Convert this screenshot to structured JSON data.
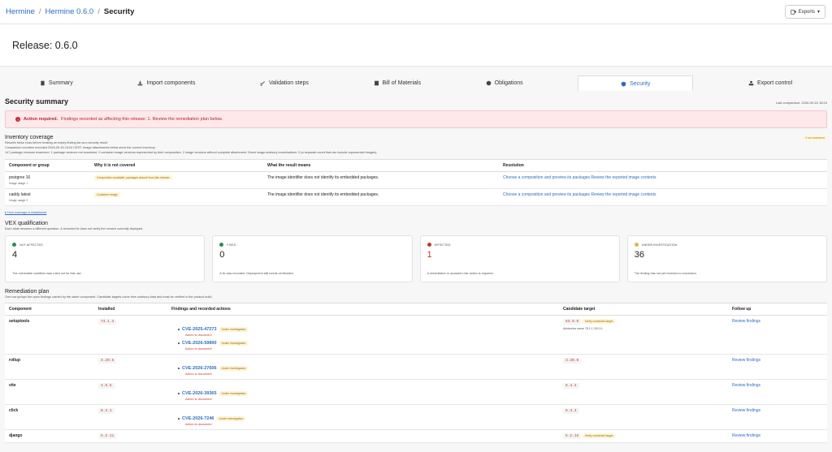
{
  "breadcrumb": {
    "root": "Hermine",
    "release": "Hermine 0.6.0",
    "current": "Security"
  },
  "header": {
    "exports_label": "Exports",
    "release_title": "Release: 0.6.0"
  },
  "tabs": [
    {
      "label": "Summary",
      "icon": "document-icon"
    },
    {
      "label": "Import components",
      "icon": "import-icon"
    },
    {
      "label": "Validation steps",
      "icon": "checks-icon"
    },
    {
      "label": "Bill of Materials",
      "icon": "book-icon"
    },
    {
      "label": "Obligations",
      "icon": "circle-icon"
    },
    {
      "label": "Security",
      "icon": "shield-icon",
      "active": true
    },
    {
      "label": "Export control",
      "icon": "export-icon"
    }
  ],
  "security": {
    "title": "Security summary",
    "last_comparison": "Last comparison: 2026-09-16 18:24",
    "alert_strong": "Action required.",
    "alert_text": "Findings recorded as affecting this release: 1. Review the remediation plan below."
  },
  "inventory": {
    "title": "Inventory coverage",
    "badge": "3 not examined",
    "line1": "Resolve these rows before treating an empty finding list as a security result.",
    "line2": "Comparison counters recorded 2026-09-16 18:24 CEST. Image attachments below show the current inventory.",
    "line3": "147 package versions examined. 1 package versions not examined. 0 container image versions represented by their composition. 2 image versions without complete attachment. Direct image advisory examinations: 0 (a separate count that can include represented images).",
    "columns": [
      "Component or group",
      "Why it is not covered",
      "What the result means",
      "Resolution"
    ],
    "rows": [
      {
        "name": "postgres 16",
        "sub": "Image usage 1",
        "why": "Composition available; packages absent from this release",
        "meaning": "The image identifier does not identify its embedded packages.",
        "resolution": "Choose a composition and preview its packages Review the reported image contents"
      },
      {
        "name": "caddy latest",
        "sub": "Image usage 2",
        "why": "Container image",
        "meaning": "The image identifier does not identify its embedded packages.",
        "resolution": "Choose a composition and preview its packages Review the reported image contents"
      }
    ],
    "how_link": "▸ How coverage is established"
  },
  "vex": {
    "title": "VEX qualification",
    "subtitle": "Each state answers a different question. A recorded fix does not verify the version currently deployed.",
    "cards": [
      {
        "label": "NOT AFFECTED",
        "value": "4",
        "desc": "The vulnerable condition was ruled out for this use.",
        "color": "#2e8b57"
      },
      {
        "label": "FIXED",
        "value": "0",
        "desc": "A fix was recorded. Deployment still needs verification.",
        "color": "#2e8b57"
      },
      {
        "label": "AFFECTED",
        "value": "1",
        "desc": "A remediation or accepted risk action is required.",
        "color": "#c0392b"
      },
      {
        "label": "UNDER INVESTIGATION",
        "value": "36",
        "desc": "The finding has not yet received a conclusion.",
        "color": "#e0b84a"
      }
    ]
  },
  "remediation": {
    "title": "Remediation plan",
    "subtitle": "One row groups the open findings carried by the same component. Candidate targets come from advisory data and must be verified in the product build.",
    "columns": [
      "Component",
      "Installed",
      "Findings and recorded actions",
      "Candidate target",
      "Follow up"
    ],
    "rows": [
      {
        "component": "setuptools",
        "installed": "74.1.3",
        "findings": [
          {
            "cve": "CVE-2025-47273",
            "status": "Under investigation",
            "action": "Action to document"
          },
          {
            "cve": "CVE-2026-59890",
            "status": "Under investigation",
            "action": "Action to document"
          }
        ],
        "target": "83.0.0",
        "target_badge": "Verify combined target",
        "target_note": "Advisories name 78.1.1, 83.0.0.",
        "follow": "Review findings"
      },
      {
        "component": "rollup",
        "installed": "3.29.5",
        "findings": [
          {
            "cve": "CVE-2026-27606",
            "status": "Under investigation",
            "action": "Action to document"
          }
        ],
        "target": "3.30.0",
        "target_badge": "",
        "target_note": "",
        "follow": "Review findings"
      },
      {
        "component": "vite",
        "installed": "4.5.5",
        "findings": [
          {
            "cve": "CVE-2026-39365",
            "status": "Under investigation",
            "action": "Action to document"
          }
        ],
        "target": "6.4.2",
        "target_badge": "",
        "target_note": "",
        "follow": "Review findings"
      },
      {
        "component": "click",
        "installed": "8.3.1",
        "findings": [
          {
            "cve": "CVE-2026-7246",
            "status": "Under investigation",
            "action": "Action to document"
          }
        ],
        "target": "8.3.3",
        "target_badge": "",
        "target_note": "",
        "follow": "Review findings"
      },
      {
        "component": "django",
        "installed": "5.2.11",
        "findings": [],
        "target": "5.2.16",
        "target_badge": "Verify combined target",
        "target_note": "",
        "follow": "Review findings"
      }
    ]
  }
}
